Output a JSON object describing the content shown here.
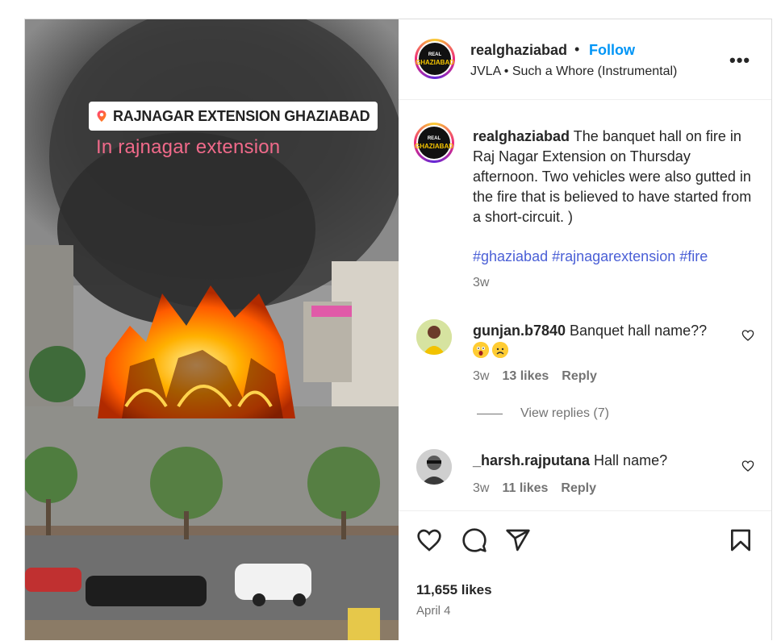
{
  "overlay": {
    "location": "RAJNAGAR EXTENSION GHAZIABAD",
    "subtitle": "In rajnagar extension"
  },
  "header": {
    "username": "realghaziabad",
    "separator": "•",
    "follow_label": "Follow",
    "audio": "JVLA • Such a Whore (Instrumental)",
    "more": "•••",
    "logo_line1": "REAL",
    "logo_line2": "GHAZIABAD"
  },
  "caption": {
    "username": "realghaziabad",
    "text": " The banquet hall on fire in Raj Nagar Extension on Thursday afternoon. Two vehicles were also gutted in the fire that is believed to have started from a short-circuit. )",
    "hashtags": [
      "#ghaziabad",
      "#rajnagarextension",
      "#fire"
    ],
    "time": "3w"
  },
  "comments": [
    {
      "username": "gunjan.b7840",
      "text": " Banquet hall name??",
      "time": "3w",
      "likes": "13 likes",
      "reply_label": "Reply"
    },
    {
      "username": "_harsh.rajputana",
      "text": " Hall name?",
      "time": "3w",
      "likes": "11 likes",
      "reply_label": "Reply"
    }
  ],
  "view_replies": "View replies (7)",
  "post": {
    "likes": "11,655 likes",
    "date": "April 4"
  },
  "colors": {
    "link_blue": "#0095f6",
    "hashtag": "#4a5fd6",
    "muted": "#737373"
  }
}
